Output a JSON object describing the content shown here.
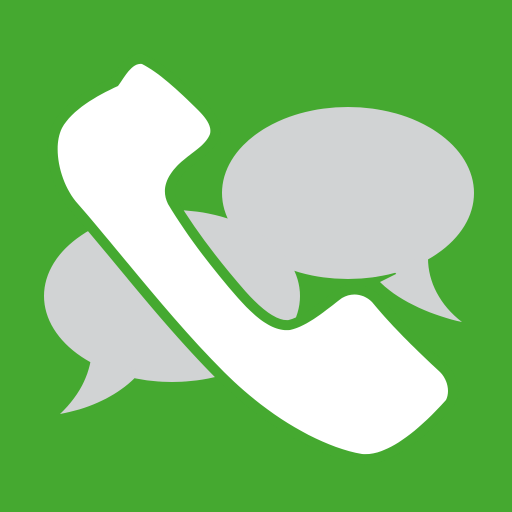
{
  "icon": {
    "name": "phone-chat-app-icon",
    "glyphs": [
      "phone-handset-icon",
      "chat-bubble-icon",
      "chat-bubble-icon"
    ],
    "colors": {
      "background": "#45a930",
      "bubble": "#d1d3d4",
      "handset": "#ffffff"
    }
  }
}
